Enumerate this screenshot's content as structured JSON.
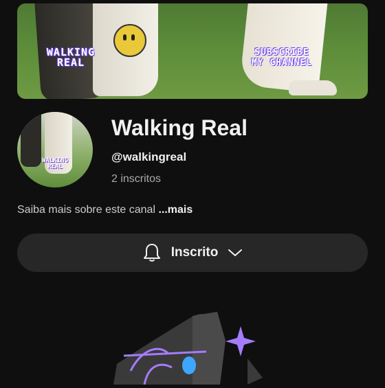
{
  "banner": {
    "left_text": "WALKING\nREAL",
    "right_text": "SUBSCRIBE\nMY CHANNEL"
  },
  "avatar": {
    "text": "WALKING\nREAL"
  },
  "channel": {
    "name": "Walking Real",
    "handle": "@walkingreal",
    "subscribers": "2 inscritos"
  },
  "about": {
    "text": "Saiba mais sobre este canal ",
    "more_label": "...mais"
  },
  "subscribe_button": {
    "label": "Inscrito",
    "icons": [
      "bell-icon",
      "chevron-down-icon"
    ]
  },
  "colors": {
    "background": "#0f0f0f",
    "button": "#272727",
    "muted_text": "#aaaaaa",
    "accent_purple": "#a57cff",
    "accent_blue": "#3ea6ff"
  }
}
